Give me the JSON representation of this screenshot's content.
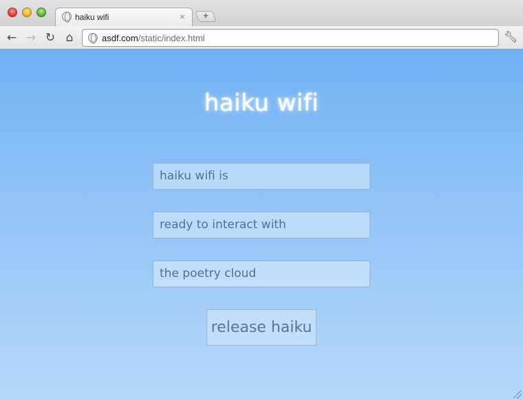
{
  "window": {
    "tab": {
      "title": "haiku wifi",
      "close_glyph": "×"
    },
    "new_tab_glyph": "+",
    "toolbar": {
      "back_icon": "arrow-left-icon",
      "forward_icon": "arrow-right-icon",
      "reload_icon": "reload-icon",
      "home_icon": "home-icon",
      "settings_icon": "wrench-icon"
    },
    "address": {
      "host": "asdf.com",
      "path": "/static/index.html"
    }
  },
  "page": {
    "title": "haiku wifi",
    "lines": [
      "haiku wifi is",
      "ready to interact with",
      "the poetry cloud"
    ],
    "submit_label": "release haiku",
    "colors": {
      "background_top": "#6fb0f4",
      "background_bottom": "#b5d8fb",
      "title": "#ffffff",
      "field_text": "#4f6f95"
    }
  }
}
